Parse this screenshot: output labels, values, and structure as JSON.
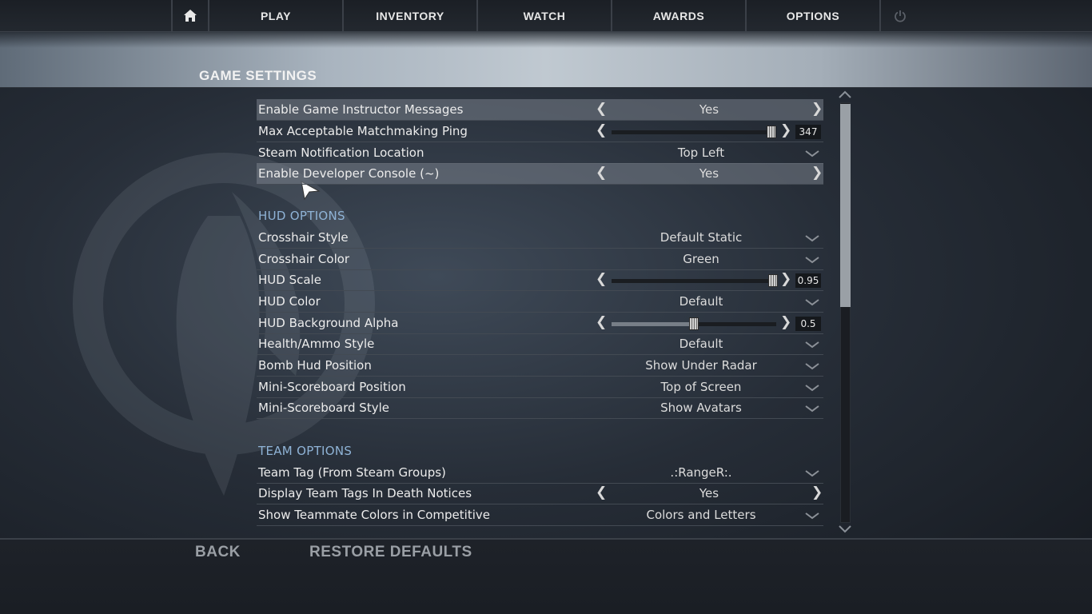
{
  "nav": {
    "items": [
      {
        "label": "PLAY"
      },
      {
        "label": "INVENTORY"
      },
      {
        "label": "WATCH"
      },
      {
        "label": "AWARDS"
      },
      {
        "label": "OPTIONS"
      }
    ],
    "home_icon": "home-icon",
    "power_icon": "power-icon"
  },
  "page_title": "GAME SETTINGS",
  "game_settings": [
    {
      "label": "Enable Game Instructor Messages",
      "value": "Yes",
      "control": "cycle"
    },
    {
      "label": "Max Acceptable Matchmaking Ping",
      "value": "347",
      "control": "slider",
      "level": 0.97
    },
    {
      "label": "Steam Notification Location",
      "value": "Top Left",
      "control": "dropdown"
    },
    {
      "label": "Enable Developer Console (~)",
      "value": "Yes",
      "control": "cycle"
    }
  ],
  "hud_section_title": "HUD OPTIONS",
  "hud_settings": [
    {
      "label": "Crosshair Style",
      "value": "Default Static",
      "control": "dropdown"
    },
    {
      "label": "Crosshair Color",
      "value": "Green",
      "control": "dropdown"
    },
    {
      "label": "HUD Scale",
      "value": "0.95",
      "control": "slider",
      "level": 0.98
    },
    {
      "label": "HUD Color",
      "value": "Default",
      "control": "dropdown"
    },
    {
      "label": "HUD Background Alpha",
      "value": "0.5",
      "control": "slider",
      "level": 0.5
    },
    {
      "label": "Health/Ammo Style",
      "value": "Default",
      "control": "dropdown"
    },
    {
      "label": "Bomb Hud Position",
      "value": "Show Under Radar",
      "control": "dropdown"
    },
    {
      "label": "Mini-Scoreboard Position",
      "value": "Top of Screen",
      "control": "dropdown"
    },
    {
      "label": "Mini-Scoreboard Style",
      "value": "Show Avatars",
      "control": "dropdown"
    }
  ],
  "team_section_title": "TEAM OPTIONS",
  "team_settings": [
    {
      "label": "Team Tag (From Steam Groups)",
      "value": ".:RangeR:.",
      "control": "dropdown"
    },
    {
      "label": "Display Team Tags In Death Notices",
      "value": "Yes",
      "control": "cycle"
    },
    {
      "label": "Show Teammate Colors in Competitive",
      "value": "Colors and Letters",
      "control": "dropdown"
    }
  ],
  "footer": {
    "back_label": "BACK",
    "restore_label": "RESTORE DEFAULTS"
  },
  "scroll_position": 0.0
}
